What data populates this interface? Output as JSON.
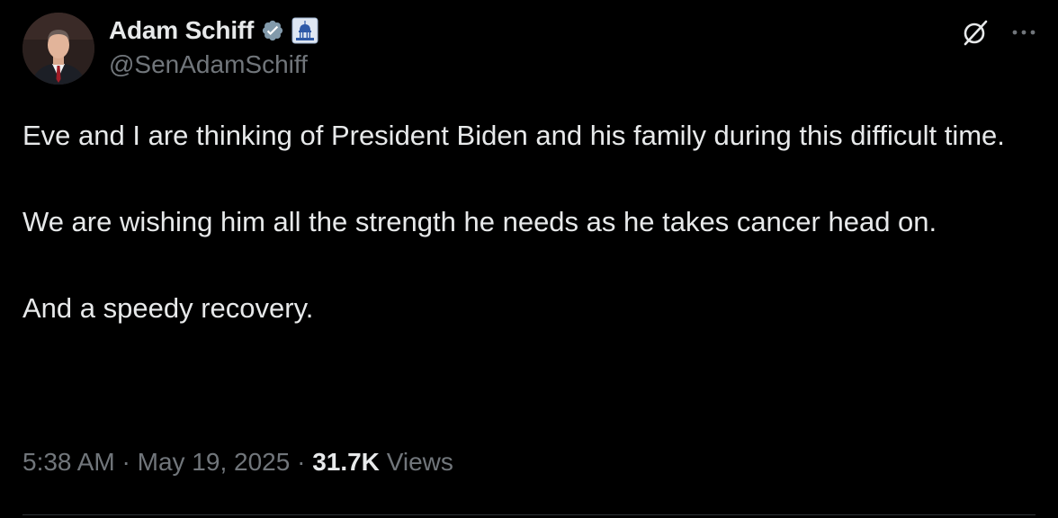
{
  "author": {
    "display_name": "Adam Schiff",
    "handle": "@SenAdamSchiff",
    "verified_icon": "verified-badge-icon",
    "affiliation_icon": "capitol-building-icon"
  },
  "actions": {
    "grok_icon": "grok-icon",
    "more_icon": "more-options-icon"
  },
  "tweet": {
    "paragraphs": [
      "Eve and I are thinking of President Biden and his family during this difficult time.",
      "We are wishing him all the strength he needs as he takes cancer head on.",
      "And a speedy recovery."
    ]
  },
  "meta": {
    "time": "5:38 AM",
    "separator": "·",
    "date": "May 19, 2025",
    "views_count": "31.7K",
    "views_label": "Views"
  },
  "colors": {
    "background": "#000000",
    "primary_text": "#e7e9ea",
    "secondary_text": "#71767b",
    "verified_blue": "#829aab",
    "divider": "#2f3336"
  }
}
